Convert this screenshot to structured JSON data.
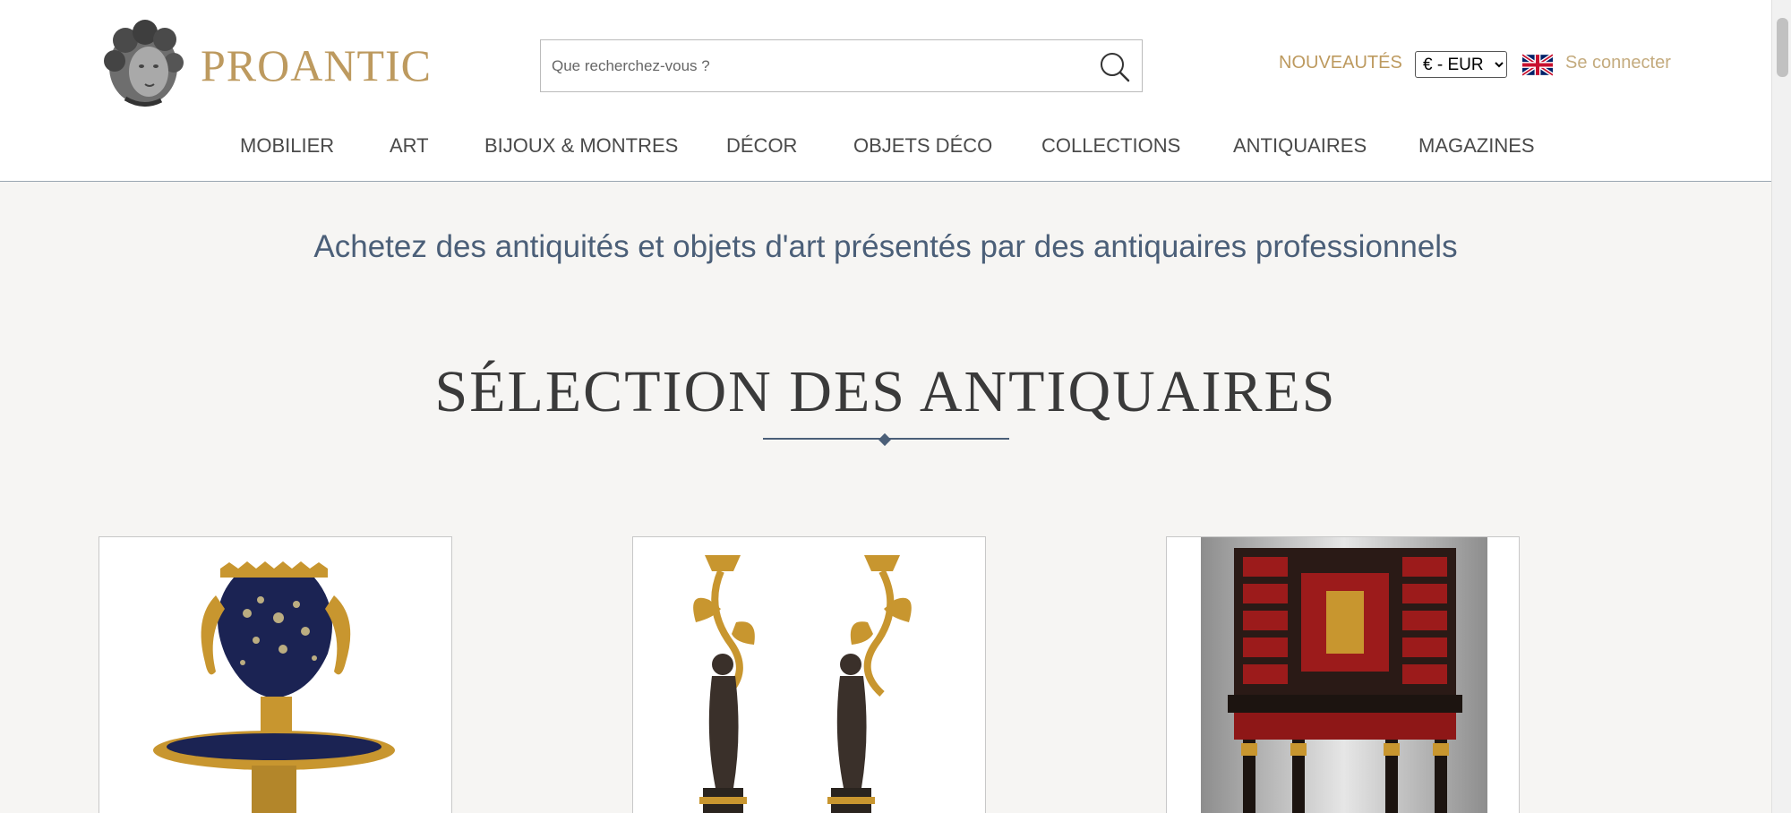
{
  "header": {
    "logo_text": "PROANTIC",
    "search_placeholder": "Que recherchez-vous ?",
    "nouveautes_label": "NOUVEAUTÉS",
    "currency_selected": "€ - EUR",
    "login_label": "Se connecter",
    "brand_color": "#bd9a5f"
  },
  "nav": {
    "items": [
      {
        "label": "MOBILIER"
      },
      {
        "label": "ART"
      },
      {
        "label": "BIJOUX & MONTRES"
      },
      {
        "label": "DÉCOR"
      },
      {
        "label": "OBJETS DÉCO"
      },
      {
        "label": "COLLECTIONS"
      },
      {
        "label": "ANTIQUAIRES"
      },
      {
        "label": "MAGAZINES"
      }
    ]
  },
  "main": {
    "tagline": "Achetez des antiquités et objets d'art présentés par des antiquaires professionnels",
    "section_title": "SÉLECTION DES ANTIQUAIRES",
    "accent_color": "#4b5f78"
  },
  "icons": {
    "logo": "cherub-head-icon",
    "search": "search-icon",
    "flag": "uk-flag-icon"
  },
  "products": [
    {
      "image": "cobalt-vase-with-ormolu-mounts"
    },
    {
      "image": "pair-of-bronze-candelabra"
    },
    {
      "image": "tortoiseshell-cabinet-on-stand"
    }
  ]
}
